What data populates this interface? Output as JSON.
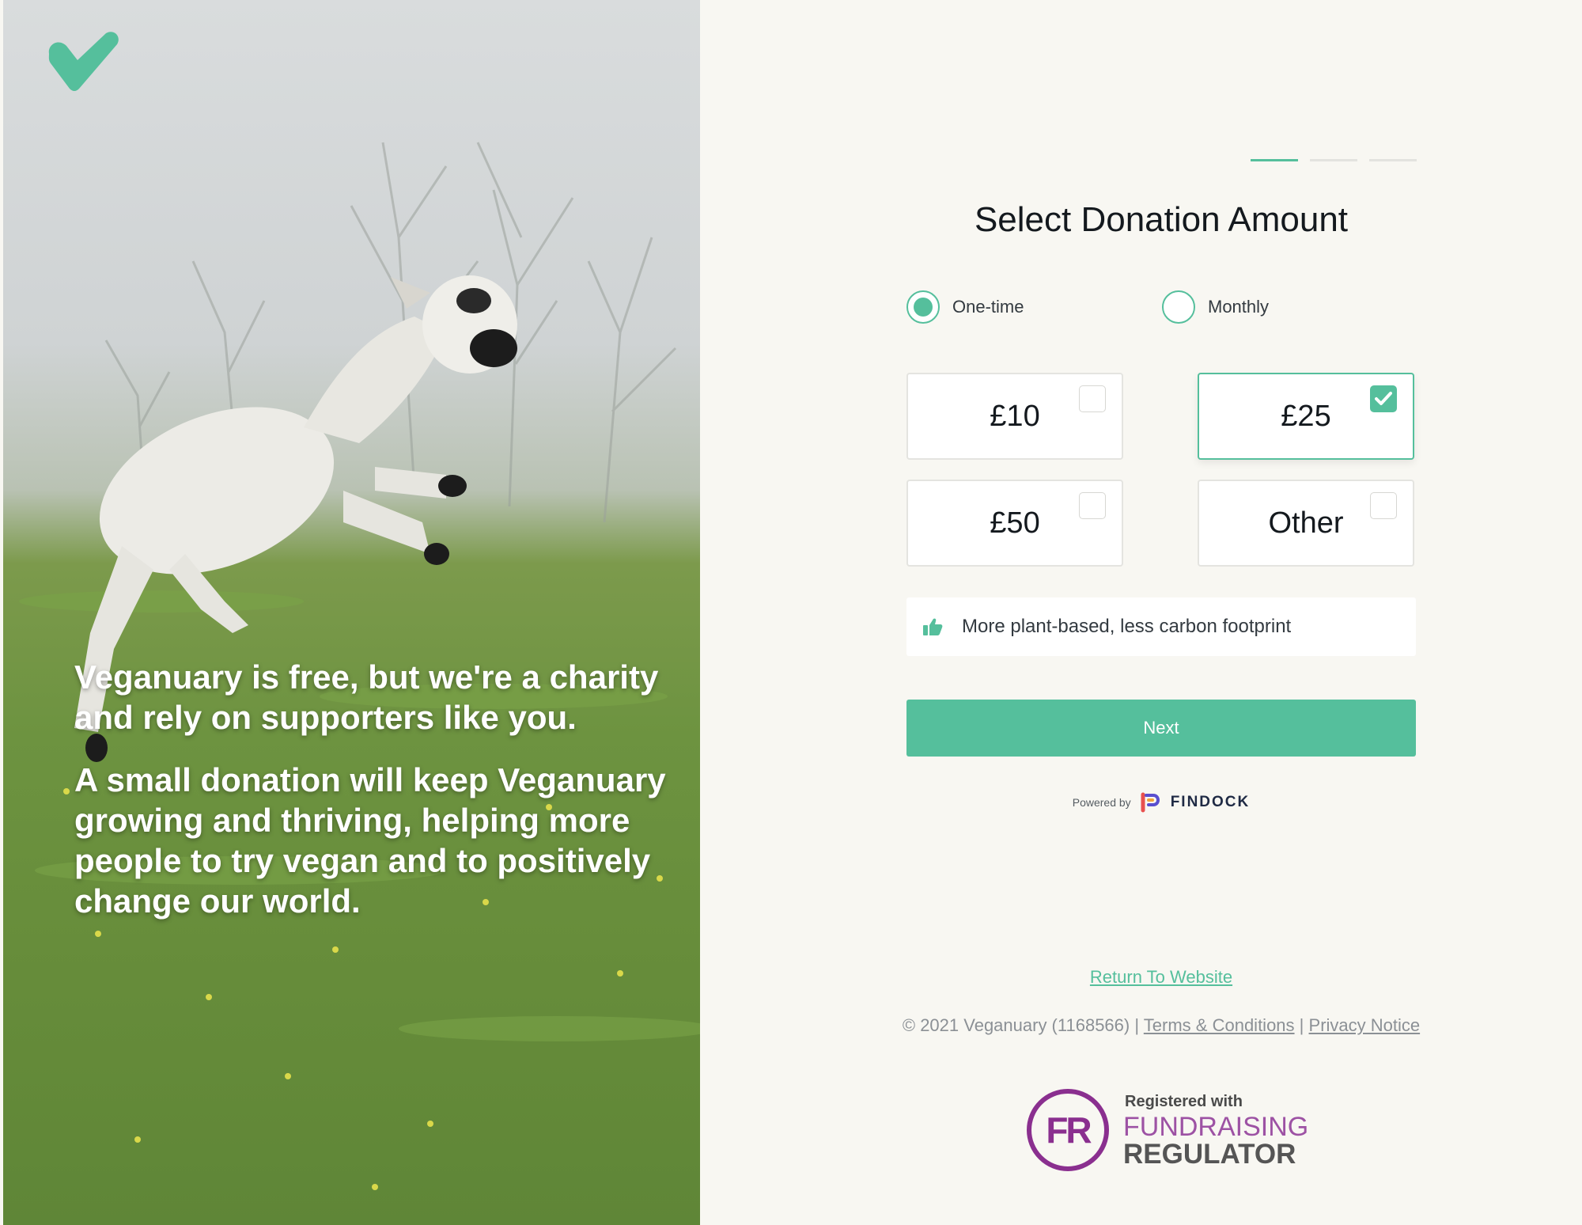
{
  "hero": {
    "paragraph_1": "Veganuary is free, but we're a charity and rely on supporters like you.",
    "paragraph_2": "A small donation will keep Veganuary growing and thriving, helping more people to try vegan and to positively change our world."
  },
  "progress": {
    "total_steps": 3,
    "current_step": 1
  },
  "form": {
    "title": "Select Donation Amount",
    "frequency": {
      "selected": "One-time",
      "options": [
        "One-time",
        "Monthly"
      ]
    },
    "amounts": [
      {
        "label": "£10",
        "selected": false
      },
      {
        "label": "£25",
        "selected": true
      },
      {
        "label": "£50",
        "selected": false
      },
      {
        "label": "Other",
        "selected": false
      }
    ],
    "impact_message": "More plant-based, less carbon footprint",
    "next_label": "Next"
  },
  "powered_by": {
    "prefix": "Powered by",
    "brand": "FINDOCK"
  },
  "links": {
    "return": "Return To Website"
  },
  "footer": {
    "copyright": "© 2021 Veganuary (1168566)",
    "separator": "|",
    "terms": "Terms & Conditions",
    "privacy": "Privacy Notice"
  },
  "regulator": {
    "monogram": "FR",
    "line_1": "Registered with",
    "line_2": "FUNDRAISING",
    "line_3": "REGULATOR"
  },
  "colors": {
    "accent": "#55bf9c",
    "page_background": "#f8f7f2",
    "regulator_purple": "#8a2f8f"
  },
  "icons": [
    "heart-check-logo-icon",
    "thumbs-up-icon",
    "checkmark-icon",
    "findock-logo-icon"
  ]
}
